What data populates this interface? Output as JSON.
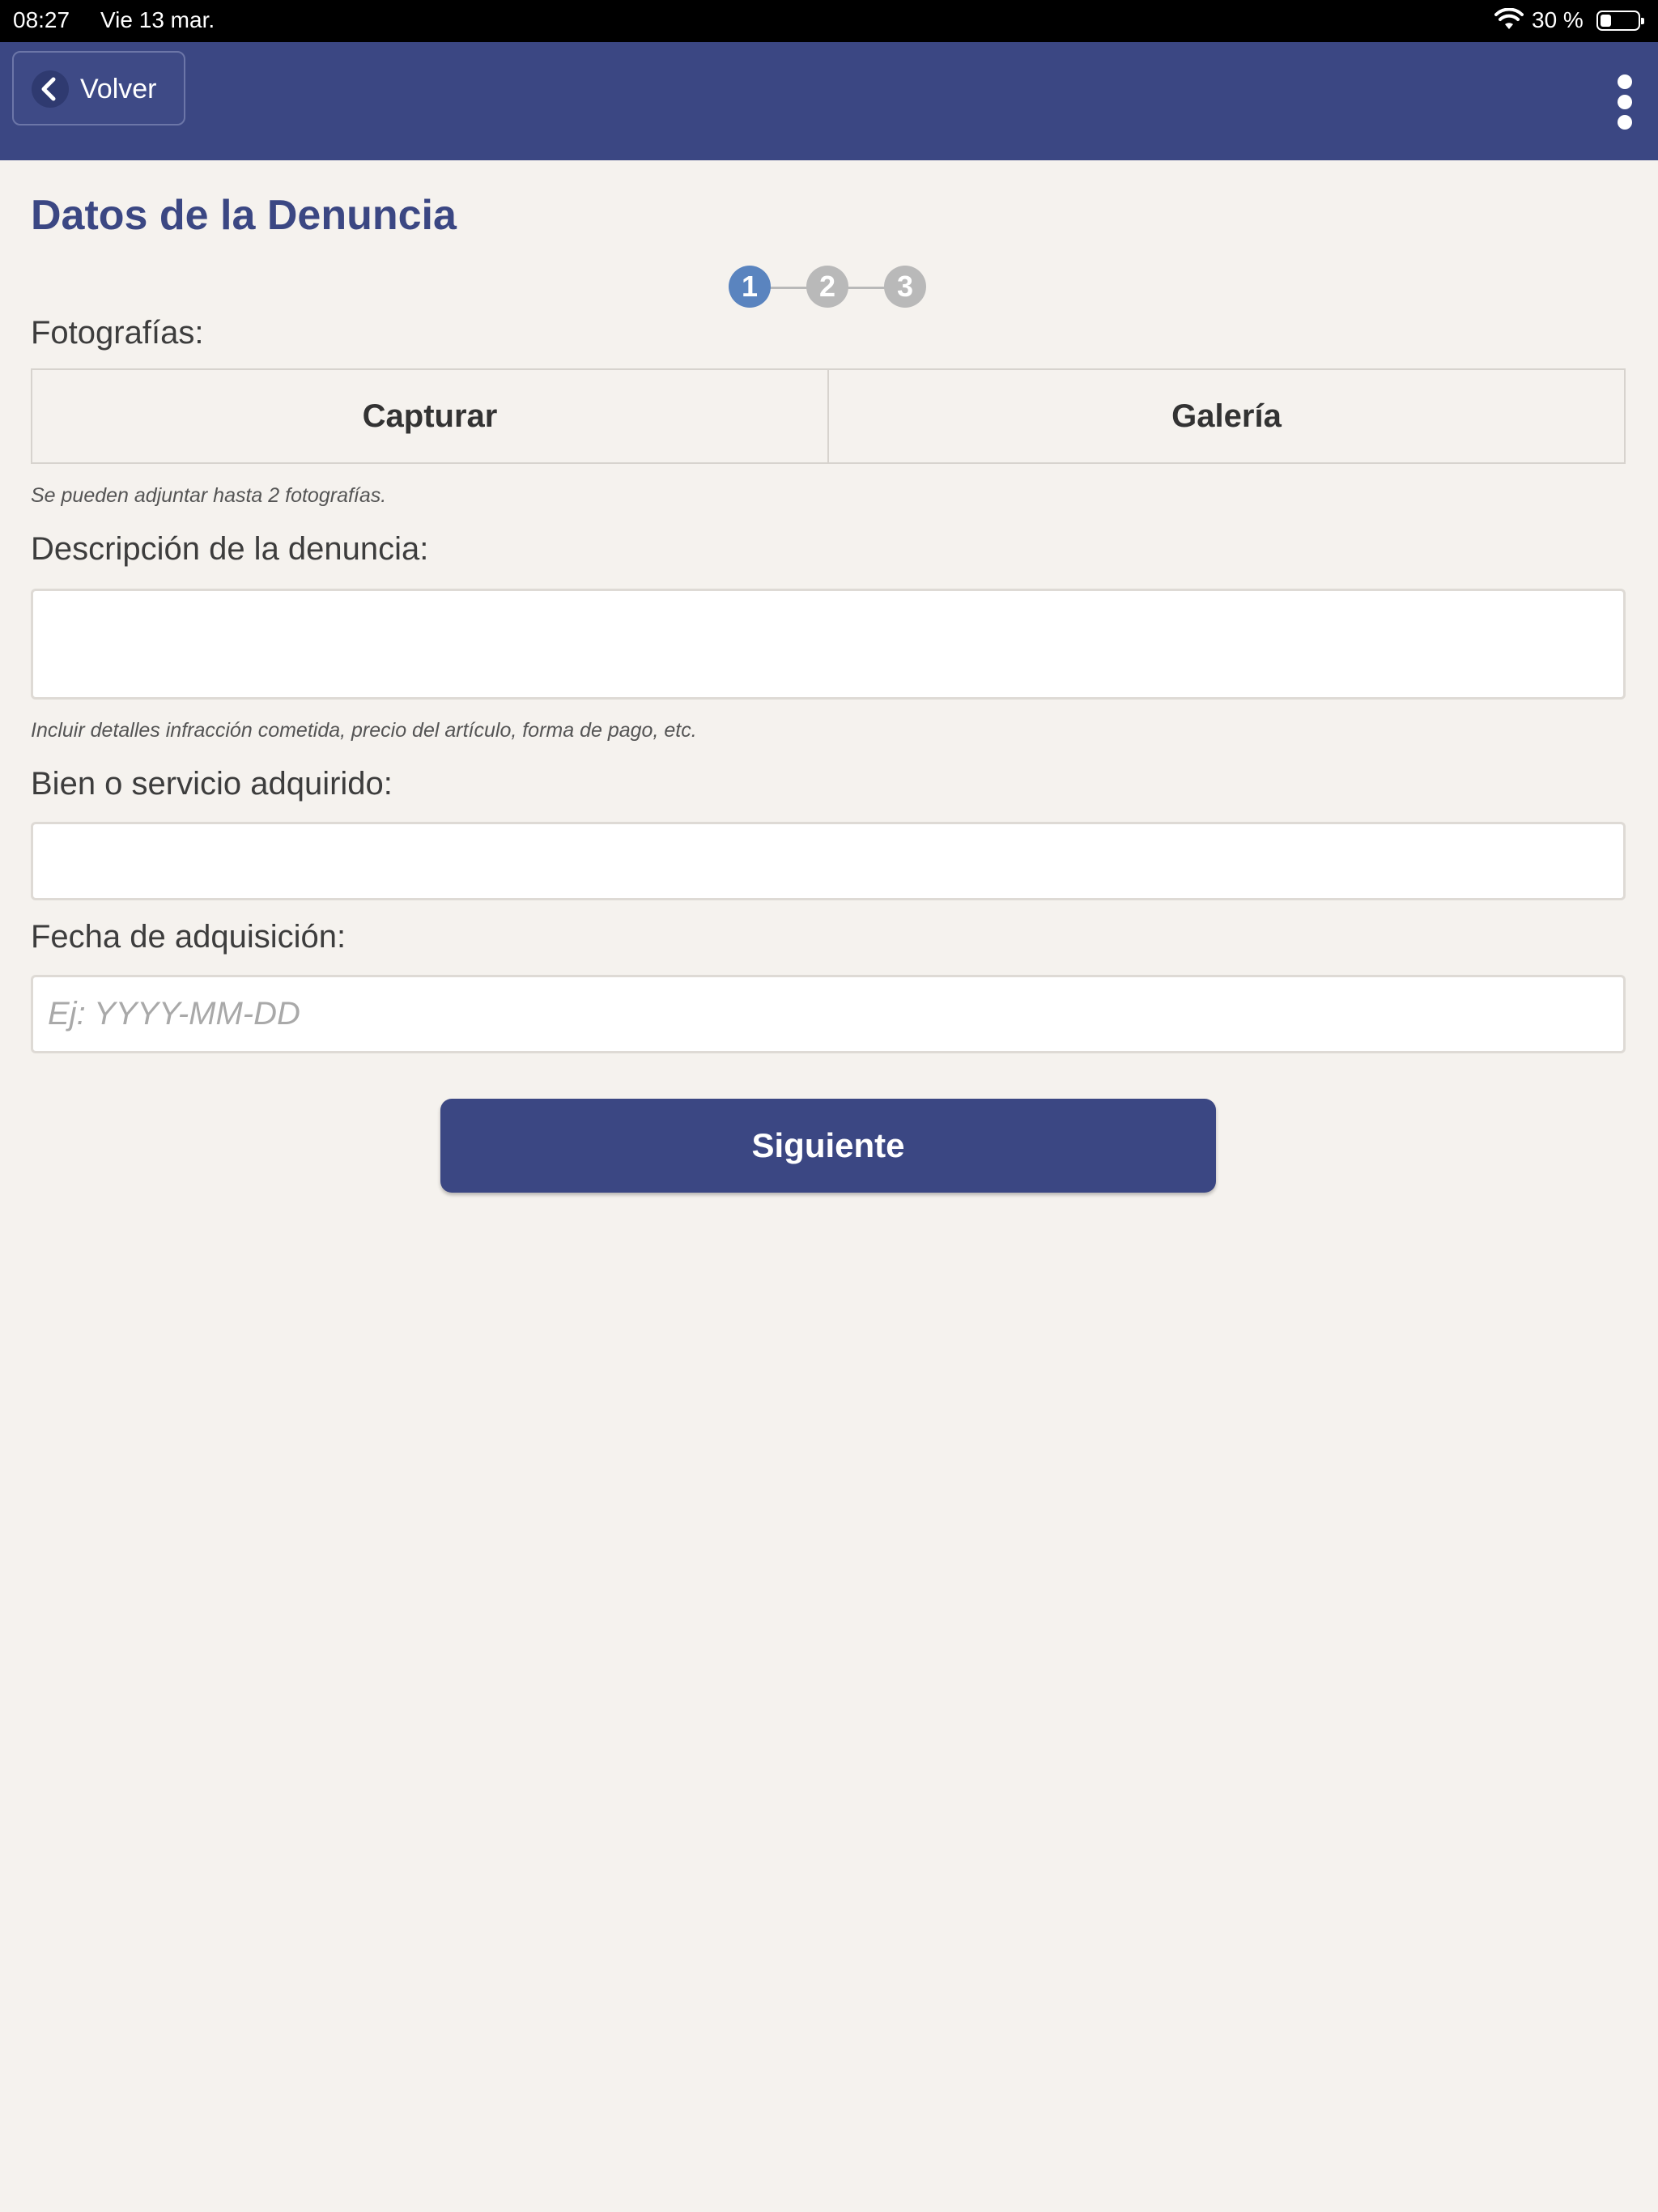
{
  "status_bar": {
    "time": "08:27",
    "date": "Vie 13 mar.",
    "battery_percent_label": "30 %",
    "battery_level": 0.3,
    "wifi_icon": "wifi-icon"
  },
  "header": {
    "back_label": "Volver",
    "back_icon": "chevron-left-icon",
    "menu_icon": "more-vertical-icon",
    "background_color": "#3b4783"
  },
  "page": {
    "title": "Datos de la Denuncia"
  },
  "stepper": {
    "steps": [
      "1",
      "2",
      "3"
    ],
    "active_step": 1,
    "active_color": "#5a84bf",
    "inactive_color": "#b9b9b9"
  },
  "form": {
    "photos": {
      "label": "Fotografías:",
      "capture_label": "Capturar",
      "gallery_label": "Galería",
      "hint": "Se pueden adjuntar hasta 2 fotografías."
    },
    "description": {
      "label": "Descripción de la denuncia:",
      "value": "",
      "hint": "Incluir detalles infracción cometida, precio del artículo, forma de pago, etc."
    },
    "product": {
      "label": "Bien o servicio adquirido:",
      "value": ""
    },
    "date": {
      "label": "Fecha de adquisición:",
      "value": "",
      "placeholder": "Ej: YYYY-MM-DD"
    },
    "next_label": "Siguiente"
  }
}
